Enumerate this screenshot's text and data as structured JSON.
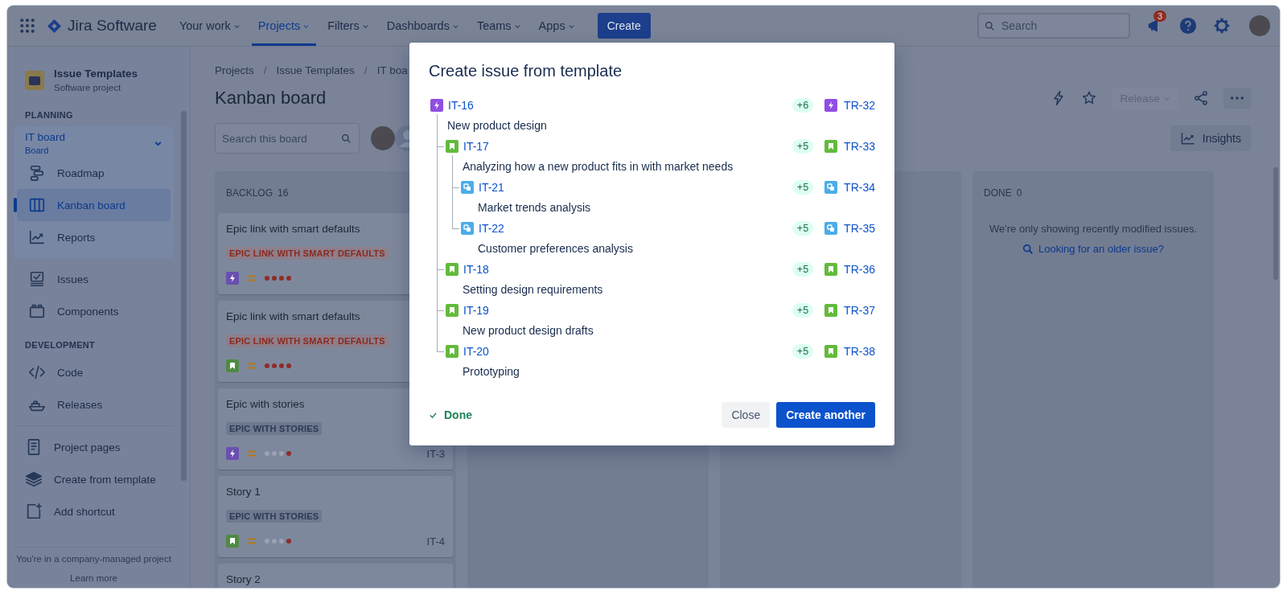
{
  "nav": {
    "app_name": "Jira Software",
    "menu": [
      {
        "label": "Your work",
        "selected": false
      },
      {
        "label": "Projects",
        "selected": true
      },
      {
        "label": "Filters",
        "selected": false
      },
      {
        "label": "Dashboards",
        "selected": false
      },
      {
        "label": "Teams",
        "selected": false
      },
      {
        "label": "Apps",
        "selected": false
      }
    ],
    "create_button": "Create",
    "search": {
      "placeholder": "Search"
    },
    "notification_count": "3"
  },
  "sidebar": {
    "project": {
      "name": "Issue Templates",
      "type": "Software project"
    },
    "planning": {
      "heading": "PLANNING",
      "board": {
        "name": "IT board",
        "subtitle": "Board",
        "expanded": true
      },
      "items": [
        {
          "kind": "roadmap",
          "label": "Roadmap",
          "selected": false
        },
        {
          "kind": "kanban",
          "label": "Kanban board",
          "selected": true
        },
        {
          "kind": "reports",
          "label": "Reports",
          "selected": false
        }
      ]
    },
    "items": [
      {
        "kind": "issues",
        "label": "Issues"
      },
      {
        "kind": "components",
        "label": "Components"
      }
    ],
    "development": {
      "heading": "DEVELOPMENT",
      "items": [
        {
          "kind": "code",
          "label": "Code"
        },
        {
          "kind": "releases",
          "label": "Releases"
        }
      ]
    },
    "shortcuts": [
      {
        "kind": "pages",
        "label": "Project pages"
      },
      {
        "kind": "template",
        "label": "Create from template"
      },
      {
        "kind": "shortcut",
        "label": "Add shortcut"
      }
    ],
    "footer": {
      "note": "You're in a company-managed project",
      "link": "Learn more"
    }
  },
  "board": {
    "breadcrumbs": [
      {
        "kind": "link",
        "text": "Projects"
      },
      {
        "kind": "separator",
        "text": "/"
      },
      {
        "kind": "link",
        "text": "Issue Templates"
      },
      {
        "kind": "separator",
        "text": "/"
      },
      {
        "kind": "link",
        "text": "IT boa"
      }
    ],
    "title": "Kanban board",
    "search": {
      "placeholder": "Search this board"
    },
    "release_button": {
      "label": "Release",
      "disabled": true
    },
    "insights_button": "Insights",
    "columns": [
      {
        "kind": "backlog",
        "title": "BACKLOG",
        "count": "16",
        "cards": [
          {
            "title": "Epic link with smart defaults",
            "tag": {
              "label": "EPIC LINK WITH SMART DEFAULTS",
              "color": "#8a2a20"
            },
            "kind": "epic",
            "stars": 4
          },
          {
            "title": "Epic link with smart defaults",
            "tag": {
              "label": "EPIC LINK WITH SMART DEFAULTS",
              "color": "#8a2a20"
            },
            "kind": "story",
            "stars": 4
          },
          {
            "title": "Epic with stories",
            "tag": {
              "label": "EPIC WITH STORIES",
              "color": "#2c3a55"
            },
            "kind": "epic",
            "stars": 1,
            "key": "IT-3"
          },
          {
            "title": "Story 1",
            "tag": {
              "label": "EPIC WITH STORIES",
              "color": "#2c3a55"
            },
            "kind": "story",
            "stars": 1,
            "key": "IT-4"
          },
          {
            "title": "Story 2"
          }
        ]
      },
      {
        "kind": "empty"
      },
      {
        "kind": "empty"
      },
      {
        "kind": "done",
        "title": "DONE",
        "count": "0",
        "message": "We're only showing recently modified issues.",
        "link": "Looking for an older issue?"
      }
    ]
  },
  "modal": {
    "title": "Create issue from template",
    "tree": [
      {
        "kind": "epic",
        "key": "IT-16",
        "summary": "New product design",
        "count": "+6",
        "target": {
          "kind": "epic",
          "key": "TR-32"
        },
        "children": [
          {
            "kind": "story",
            "key": "IT-17",
            "summary": "Analyzing how a new product fits in with market needs",
            "count": "+5",
            "target": {
              "kind": "story",
              "key": "TR-33"
            },
            "children": [
              {
                "kind": "subtask",
                "key": "IT-21",
                "summary": "Market trends analysis",
                "count": "+5",
                "target": {
                  "kind": "subtask",
                  "key": "TR-34"
                }
              },
              {
                "kind": "subtask",
                "key": "IT-22",
                "summary": "Customer preferences analysis",
                "count": "+5",
                "target": {
                  "kind": "subtask",
                  "key": "TR-35"
                }
              }
            ]
          },
          {
            "kind": "story",
            "key": "IT-18",
            "summary": "Setting design requirements",
            "count": "+5",
            "target": {
              "kind": "story",
              "key": "TR-36"
            }
          },
          {
            "kind": "story",
            "key": "IT-19",
            "summary": "New product design drafts",
            "count": "+5",
            "target": {
              "kind": "story",
              "key": "TR-37"
            }
          },
          {
            "kind": "story",
            "key": "IT-20",
            "summary": "Prototyping",
            "count": "+5",
            "target": {
              "kind": "story",
              "key": "TR-38"
            }
          }
        ]
      }
    ],
    "status": "Done",
    "buttons": [
      {
        "kind": "secondary",
        "label": "Close"
      },
      {
        "kind": "primary",
        "label": "Create another"
      }
    ]
  }
}
